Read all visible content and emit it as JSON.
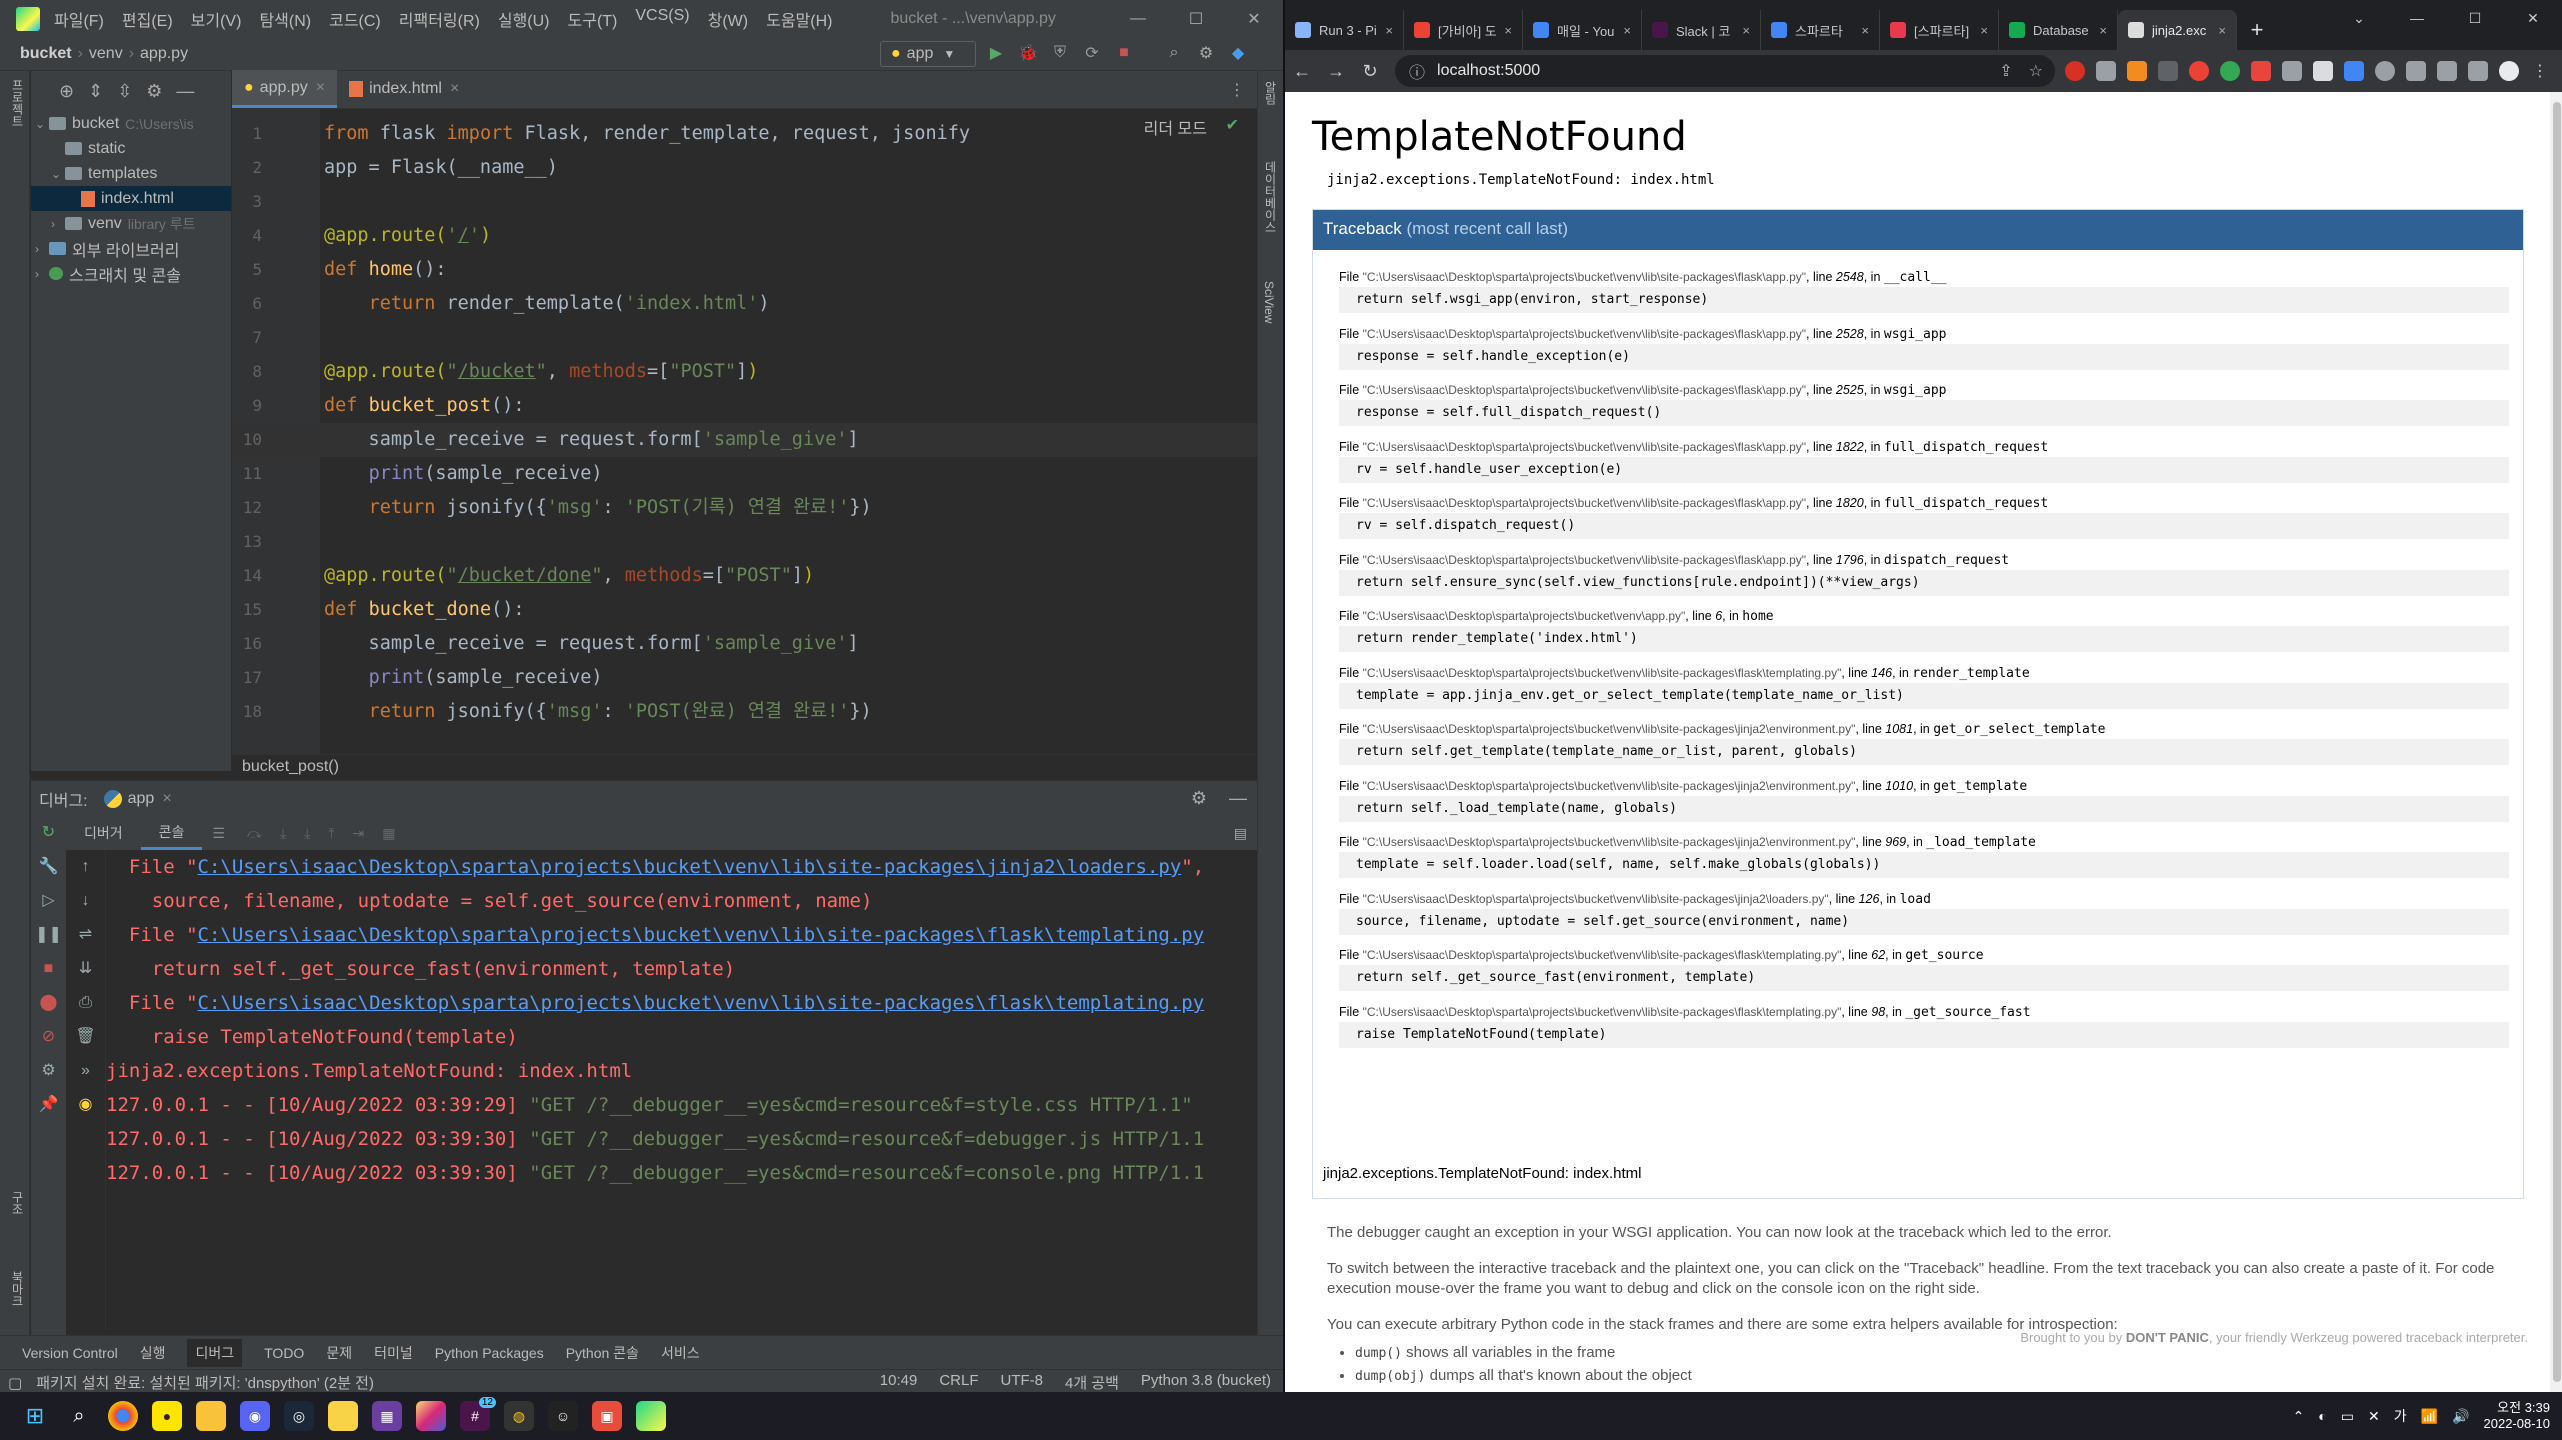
{
  "ide": {
    "menus": [
      "파일(F)",
      "편집(E)",
      "보기(V)",
      "탐색(N)",
      "코드(C)",
      "리팩터링(R)",
      "실행(U)",
      "도구(T)",
      "VCS(S)",
      "창(W)",
      "도움말(H)"
    ],
    "window_title": "bucket - ...\\venv\\app.py",
    "breadcrumb": [
      "bucket",
      "venv",
      "app.py"
    ],
    "run_config": "app",
    "project_tree": {
      "root": "bucket",
      "root_path": "C:\\Users\\is",
      "static": "static",
      "templates": "templates",
      "index": "index.html",
      "venv": "venv",
      "venv_note": "library 루트",
      "external": "외부 라이브러리",
      "scratches": "스크래치 및 콘솔"
    },
    "editor_tabs": [
      "app.py",
      "index.html"
    ],
    "reader_mode": "리더 모드",
    "code_lines": [
      {
        "n": "1",
        "html": "<span class=\"kw\">from</span> flask <span class=\"kw\">import</span> Flask, render_template, request, jsonify"
      },
      {
        "n": "2",
        "html": "app = Flask(__name__)"
      },
      {
        "n": "3",
        "html": ""
      },
      {
        "n": "4",
        "html": "<span class=\"dec\">@app.route(</span><span class=\"str\">'<span class=\"u\">/</span>'</span><span class=\"dec\">)</span>"
      },
      {
        "n": "5",
        "html": "<span class=\"kw\">def</span> <span class=\"fn\">home</span>():"
      },
      {
        "n": "6",
        "html": "    <span class=\"kw\">return</span> render_template(<span class=\"str\">'index.html'</span>)"
      },
      {
        "n": "7",
        "html": ""
      },
      {
        "n": "8",
        "html": "<span class=\"dec\">@app.route(</span><span class=\"str\">\"<span class=\"u\">/bucket</span>\"</span>, <span class=\"param\">methods</span>=[<span class=\"str\">\"POST\"</span>]<span class=\"dec\">)</span>"
      },
      {
        "n": "9",
        "html": "<span class=\"kw\">def</span> <span class=\"fn\">bucket_post</span>():"
      },
      {
        "n": "10",
        "html": "    sample_receive = request.form[<span class=\"str\">'sample_give'</span>]"
      },
      {
        "n": "11",
        "html": "    <span class=\"bi\">print</span>(sample_receive)"
      },
      {
        "n": "12",
        "html": "    <span class=\"kw\">return</span> jsonify({<span class=\"str\">'msg'</span>: <span class=\"str\">'POST(기록) 연결 완료!'</span>})"
      },
      {
        "n": "13",
        "html": ""
      },
      {
        "n": "14",
        "html": "<span class=\"dec\">@app.route(</span><span class=\"str\">\"<span class=\"u\">/bucket/done</span>\"</span>, <span class=\"param\">methods</span>=[<span class=\"str\">\"POST\"</span>]<span class=\"dec\">)</span>"
      },
      {
        "n": "15",
        "html": "<span class=\"kw\">def</span> <span class=\"fn\">bucket_done</span>():"
      },
      {
        "n": "16",
        "html": "    sample_receive = request.form[<span class=\"str\">'sample_give'</span>]"
      },
      {
        "n": "17",
        "html": "    <span class=\"bi\">print</span>(sample_receive)"
      },
      {
        "n": "18",
        "html": "    <span class=\"kw\">return</span> jsonify({<span class=\"str\">'msg'</span>: <span class=\"str\">'POST(완료) 연결 완료!'</span>})"
      }
    ],
    "current_line": "10",
    "editor_breadcrumb": "bucket_post()",
    "debug_label": "디버그:",
    "debug_tab": "app",
    "debug_subtabs": [
      "디버거",
      "콘솔"
    ],
    "console_lines": [
      {
        "html": "  File \"<span class=\"link\">C:\\Users\\isaac\\Desktop\\sparta\\projects\\bucket\\venv\\lib\\site-packages\\jinja2\\loaders.py</span>\","
      },
      {
        "html": "    source, filename, uptodate = self.get_source(environment, name)"
      },
      {
        "html": "  File \"<span class=\"link\">C:\\Users\\isaac\\Desktop\\sparta\\projects\\bucket\\venv\\lib\\site-packages\\flask\\templating.py</span>"
      },
      {
        "html": "    return self._get_source_fast(environment, template)"
      },
      {
        "html": "  File \"<span class=\"link\">C:\\Users\\isaac\\Desktop\\sparta\\projects\\bucket\\venv\\lib\\site-packages\\flask\\templating.py</span>"
      },
      {
        "html": "    raise TemplateNotFound(template)"
      },
      {
        "html": "jinja2.exceptions.TemplateNotFound: index.html"
      },
      {
        "html": "127.0.0.1 - - [10/Aug/2022 03:39:29] <span class=\"get\">\"GET /?__debugger__=yes&amp;cmd=resource&amp;f=style.css HTTP/1.1\"</span>"
      },
      {
        "html": "127.0.0.1 - - [10/Aug/2022 03:39:30] <span class=\"get\">\"GET /?__debugger__=yes&amp;cmd=resource&amp;f=debugger.js HTTP/1.1</span>"
      },
      {
        "html": "127.0.0.1 - - [10/Aug/2022 03:39:30] <span class=\"get\">\"GET /?__debugger__=yes&amp;cmd=resource&amp;f=console.png HTTP/1.1</span>"
      }
    ],
    "bottom_tabs": [
      "Version Control",
      "실행",
      "디버그",
      "TODO",
      "문제",
      "터미널",
      "Python Packages",
      "Python 콘솔",
      "서비스"
    ],
    "status_msg": "패키지 설치 완료: 설치된 패키지: 'dnspython' (2분 전)",
    "status_right": [
      "10:49",
      "CRLF",
      "UTF-8",
      "4개 공백",
      "Python 3.8 (bucket)"
    ]
  },
  "browser": {
    "tabs": [
      {
        "title": "Run 3 - Pi",
        "color": "#8ab4f8"
      },
      {
        "title": "[가비아] 도",
        "color": "#ea4335"
      },
      {
        "title": "매일 - You",
        "color": "#4285f4"
      },
      {
        "title": "Slack | 코",
        "color": "#4a154b"
      },
      {
        "title": "스파르타",
        "color": "#4285f4"
      },
      {
        "title": "[스파르타]",
        "color": "#e8394d"
      },
      {
        "title": "Database",
        "color": "#13aa52"
      },
      {
        "title": "jinja2.exc",
        "color": "#dddddd"
      }
    ],
    "url": "localhost:5000"
  },
  "page": {
    "title": "TemplateNotFound",
    "error": "jinja2.exceptions.TemplateNotFound: index.html",
    "traceback_label": "Traceback",
    "traceback_sub": "(most recent call last)",
    "frames": [
      {
        "file": "\"C:\\Users\\isaac\\Desktop\\sparta\\projects\\bucket\\venv\\lib\\site-packages\\flask\\app.py\"",
        "line": "2548",
        "func": "__call__",
        "src": "return self.wsgi_app(environ, start_response)"
      },
      {
        "file": "\"C:\\Users\\isaac\\Desktop\\sparta\\projects\\bucket\\venv\\lib\\site-packages\\flask\\app.py\"",
        "line": "2528",
        "func": "wsgi_app",
        "src": "response = self.handle_exception(e)"
      },
      {
        "file": "\"C:\\Users\\isaac\\Desktop\\sparta\\projects\\bucket\\venv\\lib\\site-packages\\flask\\app.py\"",
        "line": "2525",
        "func": "wsgi_app",
        "src": "response = self.full_dispatch_request()"
      },
      {
        "file": "\"C:\\Users\\isaac\\Desktop\\sparta\\projects\\bucket\\venv\\lib\\site-packages\\flask\\app.py\"",
        "line": "1822",
        "func": "full_dispatch_request",
        "src": "rv = self.handle_user_exception(e)"
      },
      {
        "file": "\"C:\\Users\\isaac\\Desktop\\sparta\\projects\\bucket\\venv\\lib\\site-packages\\flask\\app.py\"",
        "line": "1820",
        "func": "full_dispatch_request",
        "src": "rv = self.dispatch_request()"
      },
      {
        "file": "\"C:\\Users\\isaac\\Desktop\\sparta\\projects\\bucket\\venv\\lib\\site-packages\\flask\\app.py\"",
        "line": "1796",
        "func": "dispatch_request",
        "src": "return self.ensure_sync(self.view_functions[rule.endpoint])(**view_args)"
      },
      {
        "file": "\"C:\\Users\\isaac\\Desktop\\sparta\\projects\\bucket\\venv\\app.py\"",
        "line": "6",
        "func": "home",
        "src": "return render_template('index.html')"
      },
      {
        "file": "\"C:\\Users\\isaac\\Desktop\\sparta\\projects\\bucket\\venv\\lib\\site-packages\\flask\\templating.py\"",
        "line": "146",
        "func": "render_template",
        "src": "template = app.jinja_env.get_or_select_template(template_name_or_list)"
      },
      {
        "file": "\"C:\\Users\\isaac\\Desktop\\sparta\\projects\\bucket\\venv\\lib\\site-packages\\jinja2\\environment.py\"",
        "line": "1081",
        "func": "get_or_select_template",
        "src": "return self.get_template(template_name_or_list, parent, globals)"
      },
      {
        "file": "\"C:\\Users\\isaac\\Desktop\\sparta\\projects\\bucket\\venv\\lib\\site-packages\\jinja2\\environment.py\"",
        "line": "1010",
        "func": "get_template",
        "src": "return self._load_template(name, globals)"
      },
      {
        "file": "\"C:\\Users\\isaac\\Desktop\\sparta\\projects\\bucket\\venv\\lib\\site-packages\\jinja2\\environment.py\"",
        "line": "969",
        "func": "_load_template",
        "src": "template = self.loader.load(self, name, self.make_globals(globals))"
      },
      {
        "file": "\"C:\\Users\\isaac\\Desktop\\sparta\\projects\\bucket\\venv\\lib\\site-packages\\jinja2\\loaders.py\"",
        "line": "126",
        "func": "load",
        "src": "source, filename, uptodate = self.get_source(environment, name)"
      },
      {
        "file": "\"C:\\Users\\isaac\\Desktop\\sparta\\projects\\bucket\\venv\\lib\\site-packages\\flask\\templating.py\"",
        "line": "62",
        "func": "get_source",
        "src": "return self._get_source_fast(environment, template)"
      },
      {
        "file": "\"C:\\Users\\isaac\\Desktop\\sparta\\projects\\bucket\\venv\\lib\\site-packages\\flask\\templating.py\"",
        "line": "98",
        "func": "_get_source_fast",
        "src": "raise TemplateNotFound(template)"
      }
    ],
    "explain_1": "The debugger caught an exception in your WSGI application. You can now look at the traceback which led to the error.",
    "explain_2": "To switch between the interactive traceback and the plaintext one, you can click on the \"Traceback\" headline. From the text traceback you can also create a paste of it. For code execution mouse-over the frame you want to debug and click on the console icon on the right side.",
    "explain_3": "You can execute arbitrary Python code in the stack frames and there are some extra helpers available for introspection:",
    "helper_1_code": "dump()",
    "helper_1_text": " shows all variables in the frame",
    "helper_2_code": "dump(obj)",
    "helper_2_text": " dumps all that's known about the object",
    "brought_pre": "Brought to you by ",
    "brought_bold": "DON'T PANIC",
    "brought_post": ", your friendly Werkzeug powered traceback interpreter."
  },
  "taskbar": {
    "time": "오전 3:39",
    "date": "2022-08-10",
    "badge": "12"
  }
}
